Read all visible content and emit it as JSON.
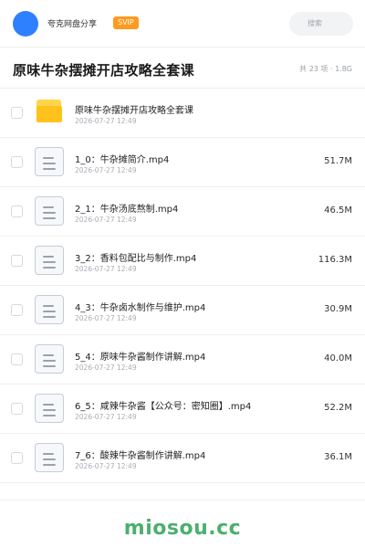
{
  "header": {
    "share_name": "夸克网盘分享",
    "badge": "SVIP",
    "search_placeholder": "搜索"
  },
  "titlebar": {
    "title": "原味牛杂摆摊开店攻略全套课",
    "summary": "共 23 项 · 1.8G"
  },
  "files": [
    {
      "type": "folder",
      "icon": "folder-icon",
      "name": "原味牛杂摆摊开店攻略全套课",
      "date": "2026-07-27 12:49",
      "size": ""
    },
    {
      "type": "file",
      "icon": "file-icon",
      "name": "1_0：牛杂摊简介.mp4",
      "date": "2026-07-27 12:49",
      "size": "51.7M"
    },
    {
      "type": "file",
      "icon": "file-icon",
      "name": "2_1：牛杂汤底熬制.mp4",
      "date": "2026-07-27 12:49",
      "size": "46.5M"
    },
    {
      "type": "file",
      "icon": "file-icon",
      "name": "3_2：香料包配比与制作.mp4",
      "date": "2026-07-27 12:49",
      "size": "116.3M"
    },
    {
      "type": "file",
      "icon": "file-icon",
      "name": "4_3：牛杂卤水制作与维护.mp4",
      "date": "2026-07-27 12:49",
      "size": "30.9M"
    },
    {
      "type": "file",
      "icon": "file-icon",
      "name": "5_4：原味牛杂酱制作讲解.mp4",
      "date": "2026-07-27 12:49",
      "size": "40.0M"
    },
    {
      "type": "file",
      "icon": "file-icon",
      "name": "6_5：咸辣牛杂酱【公众号：密知圈】.mp4",
      "date": "2026-07-27 12:49",
      "size": "52.2M"
    },
    {
      "type": "file",
      "icon": "file-icon",
      "name": "7_6：酸辣牛杂酱制作讲解.mp4",
      "date": "2026-07-27 12:49",
      "size": "36.1M"
    }
  ],
  "watermark": "miosou.cc",
  "colors": {
    "accent": "#2f80ff",
    "badge": "#ff9a1f",
    "folder": "#ffc21a",
    "watermark": "#4caf6e"
  }
}
